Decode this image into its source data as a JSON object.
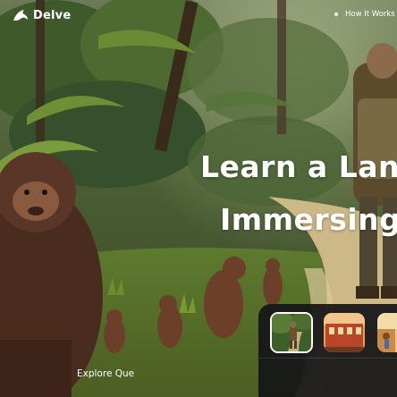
{
  "brand": {
    "name": "Delve",
    "logo_icon": "dolphin-icon"
  },
  "nav": {
    "items": [
      {
        "label": "How It Works"
      }
    ]
  },
  "hero": {
    "headline_line1": "Learn a Lang",
    "headline_line2": "Immersing"
  },
  "quests": {
    "thumbnails": [
      {
        "name": "jungle-explorer-quest-thumbnail",
        "selected": true
      },
      {
        "name": "city-building-quest-thumbnail",
        "selected": false
      },
      {
        "name": "desert-market-quest-thumbnail",
        "selected": false
      }
    ],
    "cta_label": "Explore Que"
  },
  "colors": {
    "text": "#ffffff",
    "panel": "#161618",
    "jungle_dark": "#2c3a1e",
    "path": "#d2bf8d"
  }
}
